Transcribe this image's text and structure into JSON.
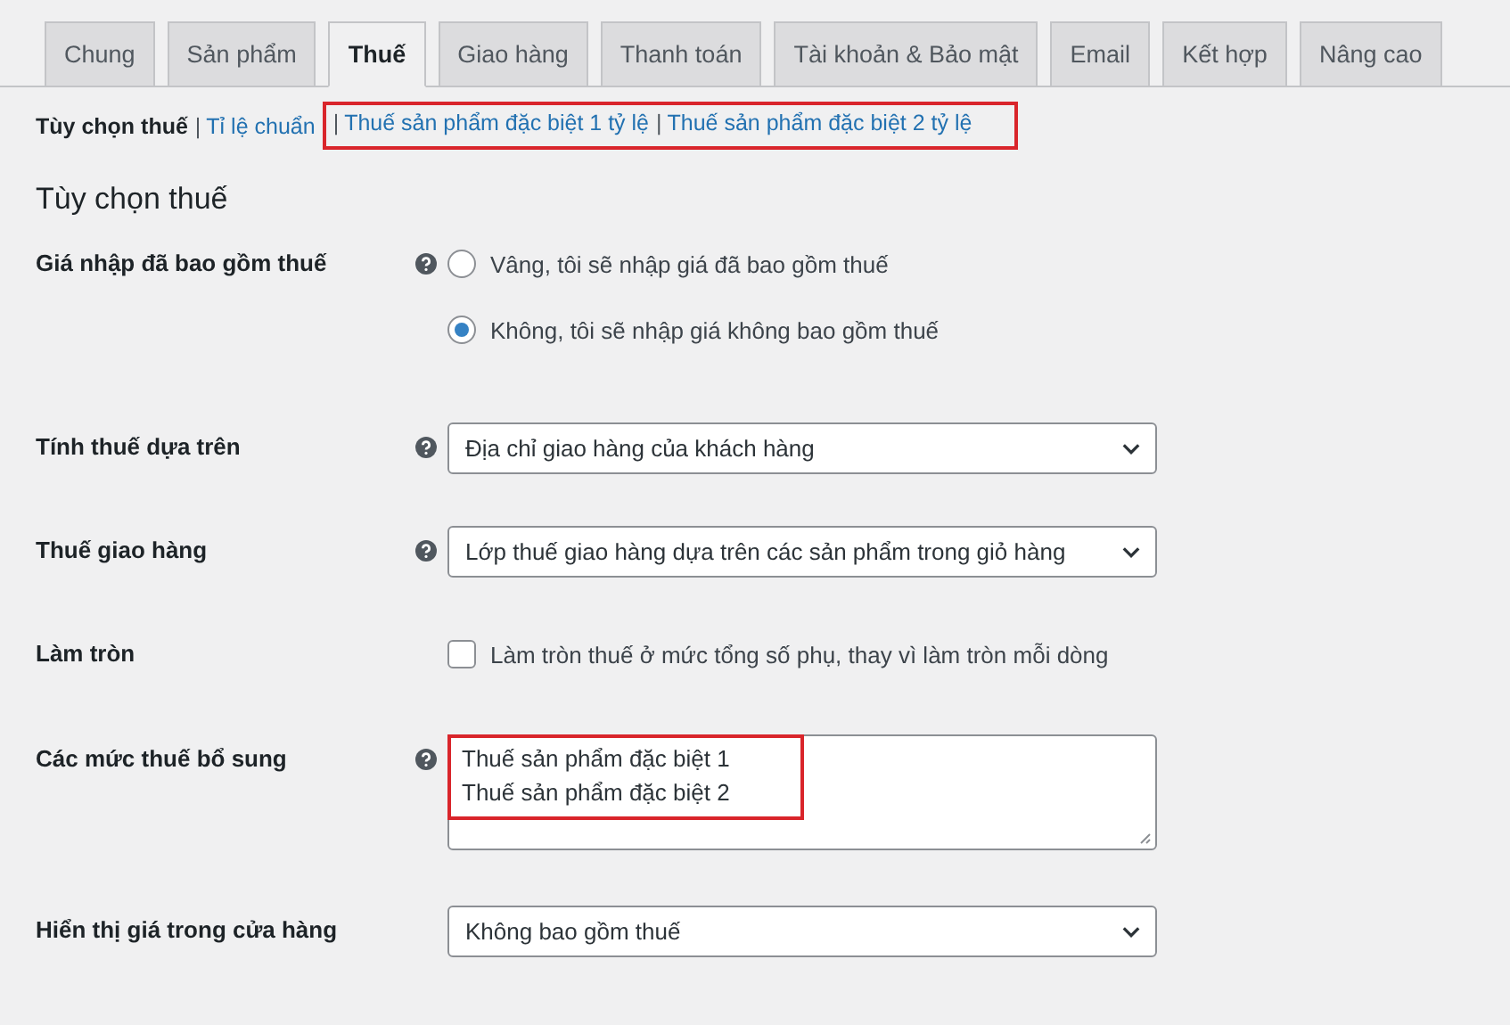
{
  "tabs": [
    {
      "label": "Chung",
      "selected": false
    },
    {
      "label": "Sản phẩm",
      "selected": false
    },
    {
      "label": "Thuế",
      "selected": true
    },
    {
      "label": "Giao hàng",
      "selected": false
    },
    {
      "label": "Thanh toán",
      "selected": false
    },
    {
      "label": "Tài khoản & Bảo mật",
      "selected": false
    },
    {
      "label": "Email",
      "selected": false
    },
    {
      "label": "Kết hợp",
      "selected": false
    },
    {
      "label": "Nâng cao",
      "selected": false
    }
  ],
  "subnav": [
    {
      "label": "Tùy chọn thuế",
      "selected": true,
      "highlighted": false
    },
    {
      "separator": "|",
      "label": "Tỉ lệ chuẩn",
      "selected": false,
      "highlighted": false
    },
    {
      "separator": "|",
      "label": "Thuế sản phẩm đặc biệt 1 tỷ lệ",
      "selected": false,
      "highlighted": true
    },
    {
      "separator": "|",
      "label": "Thuế sản phẩm đặc biệt 2 tỷ lệ",
      "selected": false,
      "highlighted": true
    }
  ],
  "heading": "Tùy chọn thuế",
  "fields": [
    {
      "kind": "radio",
      "label": "Giá nhập đã bao gồm thuế",
      "help": true,
      "options": [
        {
          "label": "Vâng, tôi sẽ nhập giá đã bao gồm thuế",
          "selected": false
        },
        {
          "label": "Không, tôi sẽ nhập giá không bao gồm thuế",
          "selected": true
        }
      ]
    },
    {
      "kind": "select",
      "label": "Tính thuế dựa trên",
      "help": true,
      "value": "Địa chỉ giao hàng của khách hàng"
    },
    {
      "kind": "select",
      "label": "Thuế giao hàng",
      "help": true,
      "value": "Lớp thuế giao hàng dựa trên các sản phẩm trong giỏ hàng"
    },
    {
      "kind": "checkbox",
      "label": "Làm tròn",
      "help": false,
      "checked": false,
      "text": "Làm tròn thuế ở mức tổng số phụ, thay vì làm tròn mỗi dòng"
    },
    {
      "kind": "textarea",
      "label": "Các mức thuế bổ sung",
      "help": true,
      "highlighted": true,
      "lines": [
        "Thuế sản phẩm đặc biệt 1",
        "Thuế sản phẩm đặc biệt 2"
      ]
    },
    {
      "kind": "select",
      "label": "Hiển thị giá trong cửa hàng",
      "help": false,
      "value": "Không bao gồm thuế"
    }
  ]
}
